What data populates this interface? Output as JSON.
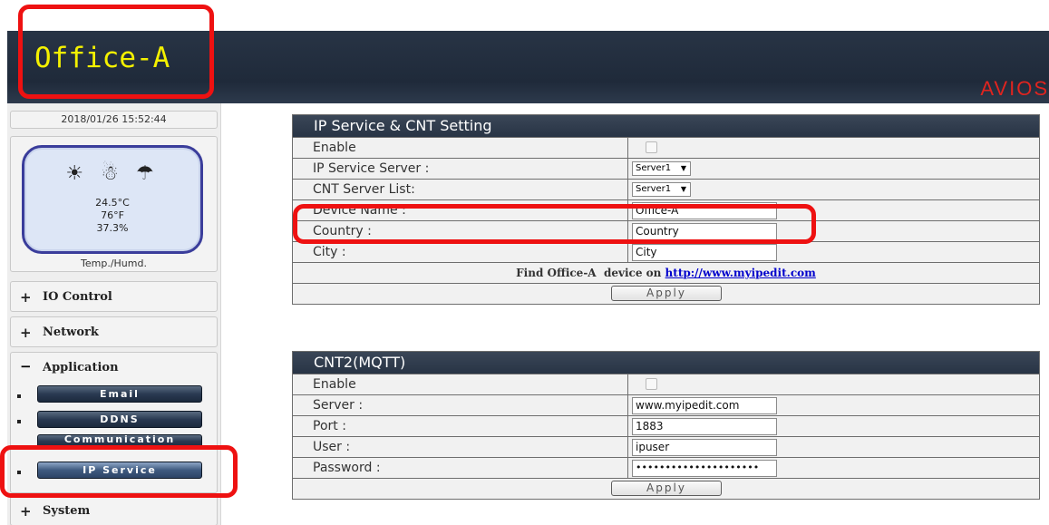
{
  "header": {
    "device_title": "Office-A",
    "brand": "AVIOS"
  },
  "sidebar": {
    "datetime": "2018/01/26 15:52:44",
    "sensor": {
      "icons": "☀ ☃ ☂",
      "temp_c": "24.5°C",
      "temp_f": "76°F",
      "humidity": "37.3%",
      "caption": "Temp./Humd."
    },
    "groups": [
      {
        "sign": "+",
        "label": "IO Control"
      },
      {
        "sign": "+",
        "label": "Network"
      },
      {
        "sign": "−",
        "label": "Application"
      },
      {
        "sign": "+",
        "label": "System"
      }
    ],
    "app_items": [
      {
        "label": "Email"
      },
      {
        "label": "DDNS"
      },
      {
        "label": "Communication"
      },
      {
        "label": "IP Service",
        "active": true
      }
    ]
  },
  "ip_service": {
    "title": "IP Service & CNT Setting",
    "enable_label": "Enable",
    "server_label": "IP Service Server :",
    "server_value": "Server1",
    "cnt_label": "CNT Server List:",
    "cnt_value": "Server1",
    "device_name_label": "Device Name :",
    "device_name_value": "Office-A",
    "country_label": "Country :",
    "country_value": "Country",
    "city_label": "City :",
    "city_value": "City",
    "find_prefix": "Find Office-A  device on ",
    "find_link": "http://www.myipedit.com",
    "apply_label": "Apply"
  },
  "mqtt": {
    "title": "CNT2(MQTT)",
    "enable_label": "Enable",
    "server_label": "Server :",
    "server_value": "www.myipedit.com",
    "port_label": "Port :",
    "port_value": "1883",
    "user_label": "User :",
    "user_value": "ipuser",
    "password_label": "Password :",
    "password_value": "•••••••••••••••••••••",
    "apply_label": "Apply"
  },
  "colors": {
    "header_bg": "#283445",
    "title_yellow": "#f4f100",
    "brand_red": "#e0241f",
    "highlight_red": "#ee1111",
    "link_blue": "#0000cc"
  }
}
